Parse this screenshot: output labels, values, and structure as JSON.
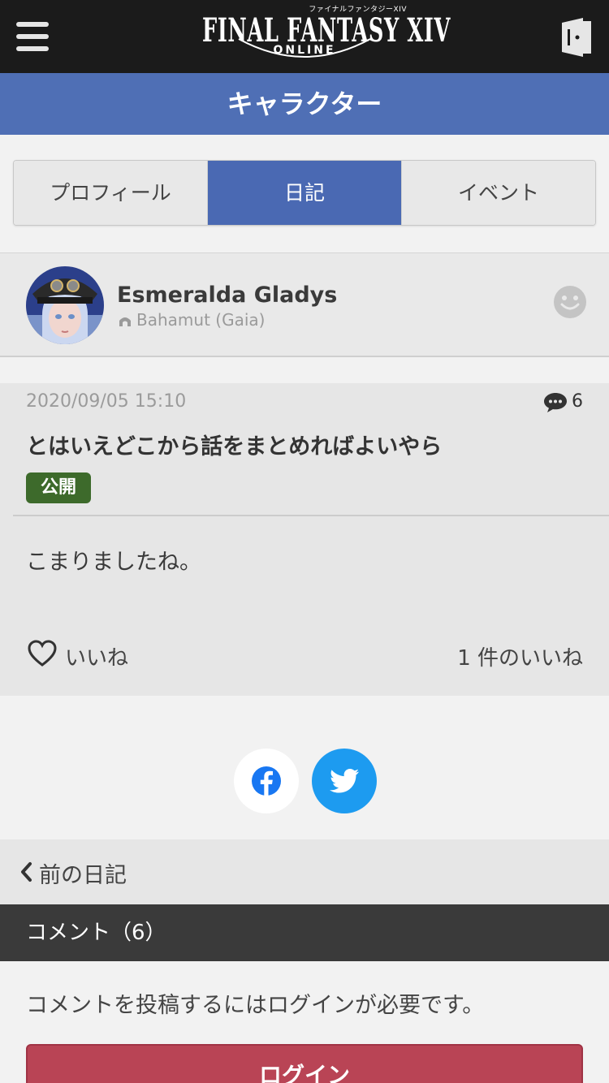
{
  "header": {
    "logo_sub": "ファイナルファンタジーXIV",
    "logo_main": "FINAL FANTASY XIV",
    "logo_online": "ONLINE"
  },
  "section": {
    "title": "キャラクター"
  },
  "tabs": [
    {
      "label": "プロフィール",
      "active": false
    },
    {
      "label": "日記",
      "active": true
    },
    {
      "label": "イベント",
      "active": false
    }
  ],
  "character": {
    "name": "Esmeralda Gladys",
    "world": "Bahamut (Gaia)"
  },
  "diary": {
    "date": "2020/09/05 15:10",
    "comment_count": "6",
    "title": "とはいえどこから話をまとめればよいやら",
    "visibility": "公開",
    "body": "こまりましたね。",
    "like_label": "いいね",
    "like_count": "1 件のいいね"
  },
  "share": {
    "facebook_icon": "facebook-icon",
    "twitter_icon": "twitter-icon"
  },
  "nav": {
    "prev_label": "前の日記"
  },
  "comments": {
    "heading": "コメント（6）",
    "login_note": "コメントを投稿するにはログインが必要です。",
    "login_button": "ログイン"
  },
  "colors": {
    "topbar": "#1b1b1b",
    "section": "#4f6fb5",
    "tab_active": "#4a69b3",
    "badge": "#3d6a2b",
    "twitter": "#1d9bf0",
    "login": "#b94455"
  }
}
